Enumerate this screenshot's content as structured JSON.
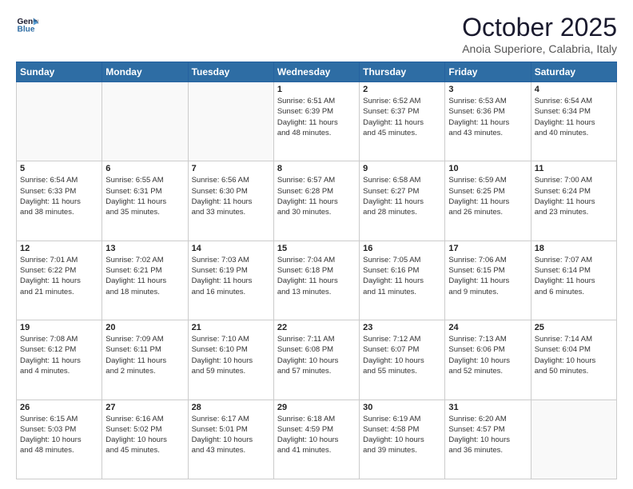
{
  "header": {
    "logo_line1": "General",
    "logo_line2": "Blue",
    "month": "October 2025",
    "location": "Anoia Superiore, Calabria, Italy"
  },
  "weekdays": [
    "Sunday",
    "Monday",
    "Tuesday",
    "Wednesday",
    "Thursday",
    "Friday",
    "Saturday"
  ],
  "weeks": [
    [
      {
        "day": "",
        "info": ""
      },
      {
        "day": "",
        "info": ""
      },
      {
        "day": "",
        "info": ""
      },
      {
        "day": "1",
        "info": "Sunrise: 6:51 AM\nSunset: 6:39 PM\nDaylight: 11 hours\nand 48 minutes."
      },
      {
        "day": "2",
        "info": "Sunrise: 6:52 AM\nSunset: 6:37 PM\nDaylight: 11 hours\nand 45 minutes."
      },
      {
        "day": "3",
        "info": "Sunrise: 6:53 AM\nSunset: 6:36 PM\nDaylight: 11 hours\nand 43 minutes."
      },
      {
        "day": "4",
        "info": "Sunrise: 6:54 AM\nSunset: 6:34 PM\nDaylight: 11 hours\nand 40 minutes."
      }
    ],
    [
      {
        "day": "5",
        "info": "Sunrise: 6:54 AM\nSunset: 6:33 PM\nDaylight: 11 hours\nand 38 minutes."
      },
      {
        "day": "6",
        "info": "Sunrise: 6:55 AM\nSunset: 6:31 PM\nDaylight: 11 hours\nand 35 minutes."
      },
      {
        "day": "7",
        "info": "Sunrise: 6:56 AM\nSunset: 6:30 PM\nDaylight: 11 hours\nand 33 minutes."
      },
      {
        "day": "8",
        "info": "Sunrise: 6:57 AM\nSunset: 6:28 PM\nDaylight: 11 hours\nand 30 minutes."
      },
      {
        "day": "9",
        "info": "Sunrise: 6:58 AM\nSunset: 6:27 PM\nDaylight: 11 hours\nand 28 minutes."
      },
      {
        "day": "10",
        "info": "Sunrise: 6:59 AM\nSunset: 6:25 PM\nDaylight: 11 hours\nand 26 minutes."
      },
      {
        "day": "11",
        "info": "Sunrise: 7:00 AM\nSunset: 6:24 PM\nDaylight: 11 hours\nand 23 minutes."
      }
    ],
    [
      {
        "day": "12",
        "info": "Sunrise: 7:01 AM\nSunset: 6:22 PM\nDaylight: 11 hours\nand 21 minutes."
      },
      {
        "day": "13",
        "info": "Sunrise: 7:02 AM\nSunset: 6:21 PM\nDaylight: 11 hours\nand 18 minutes."
      },
      {
        "day": "14",
        "info": "Sunrise: 7:03 AM\nSunset: 6:19 PM\nDaylight: 11 hours\nand 16 minutes."
      },
      {
        "day": "15",
        "info": "Sunrise: 7:04 AM\nSunset: 6:18 PM\nDaylight: 11 hours\nand 13 minutes."
      },
      {
        "day": "16",
        "info": "Sunrise: 7:05 AM\nSunset: 6:16 PM\nDaylight: 11 hours\nand 11 minutes."
      },
      {
        "day": "17",
        "info": "Sunrise: 7:06 AM\nSunset: 6:15 PM\nDaylight: 11 hours\nand 9 minutes."
      },
      {
        "day": "18",
        "info": "Sunrise: 7:07 AM\nSunset: 6:14 PM\nDaylight: 11 hours\nand 6 minutes."
      }
    ],
    [
      {
        "day": "19",
        "info": "Sunrise: 7:08 AM\nSunset: 6:12 PM\nDaylight: 11 hours\nand 4 minutes."
      },
      {
        "day": "20",
        "info": "Sunrise: 7:09 AM\nSunset: 6:11 PM\nDaylight: 11 hours\nand 2 minutes."
      },
      {
        "day": "21",
        "info": "Sunrise: 7:10 AM\nSunset: 6:10 PM\nDaylight: 10 hours\nand 59 minutes."
      },
      {
        "day": "22",
        "info": "Sunrise: 7:11 AM\nSunset: 6:08 PM\nDaylight: 10 hours\nand 57 minutes."
      },
      {
        "day": "23",
        "info": "Sunrise: 7:12 AM\nSunset: 6:07 PM\nDaylight: 10 hours\nand 55 minutes."
      },
      {
        "day": "24",
        "info": "Sunrise: 7:13 AM\nSunset: 6:06 PM\nDaylight: 10 hours\nand 52 minutes."
      },
      {
        "day": "25",
        "info": "Sunrise: 7:14 AM\nSunset: 6:04 PM\nDaylight: 10 hours\nand 50 minutes."
      }
    ],
    [
      {
        "day": "26",
        "info": "Sunrise: 6:15 AM\nSunset: 5:03 PM\nDaylight: 10 hours\nand 48 minutes."
      },
      {
        "day": "27",
        "info": "Sunrise: 6:16 AM\nSunset: 5:02 PM\nDaylight: 10 hours\nand 45 minutes."
      },
      {
        "day": "28",
        "info": "Sunrise: 6:17 AM\nSunset: 5:01 PM\nDaylight: 10 hours\nand 43 minutes."
      },
      {
        "day": "29",
        "info": "Sunrise: 6:18 AM\nSunset: 4:59 PM\nDaylight: 10 hours\nand 41 minutes."
      },
      {
        "day": "30",
        "info": "Sunrise: 6:19 AM\nSunset: 4:58 PM\nDaylight: 10 hours\nand 39 minutes."
      },
      {
        "day": "31",
        "info": "Sunrise: 6:20 AM\nSunset: 4:57 PM\nDaylight: 10 hours\nand 36 minutes."
      },
      {
        "day": "",
        "info": ""
      }
    ]
  ]
}
